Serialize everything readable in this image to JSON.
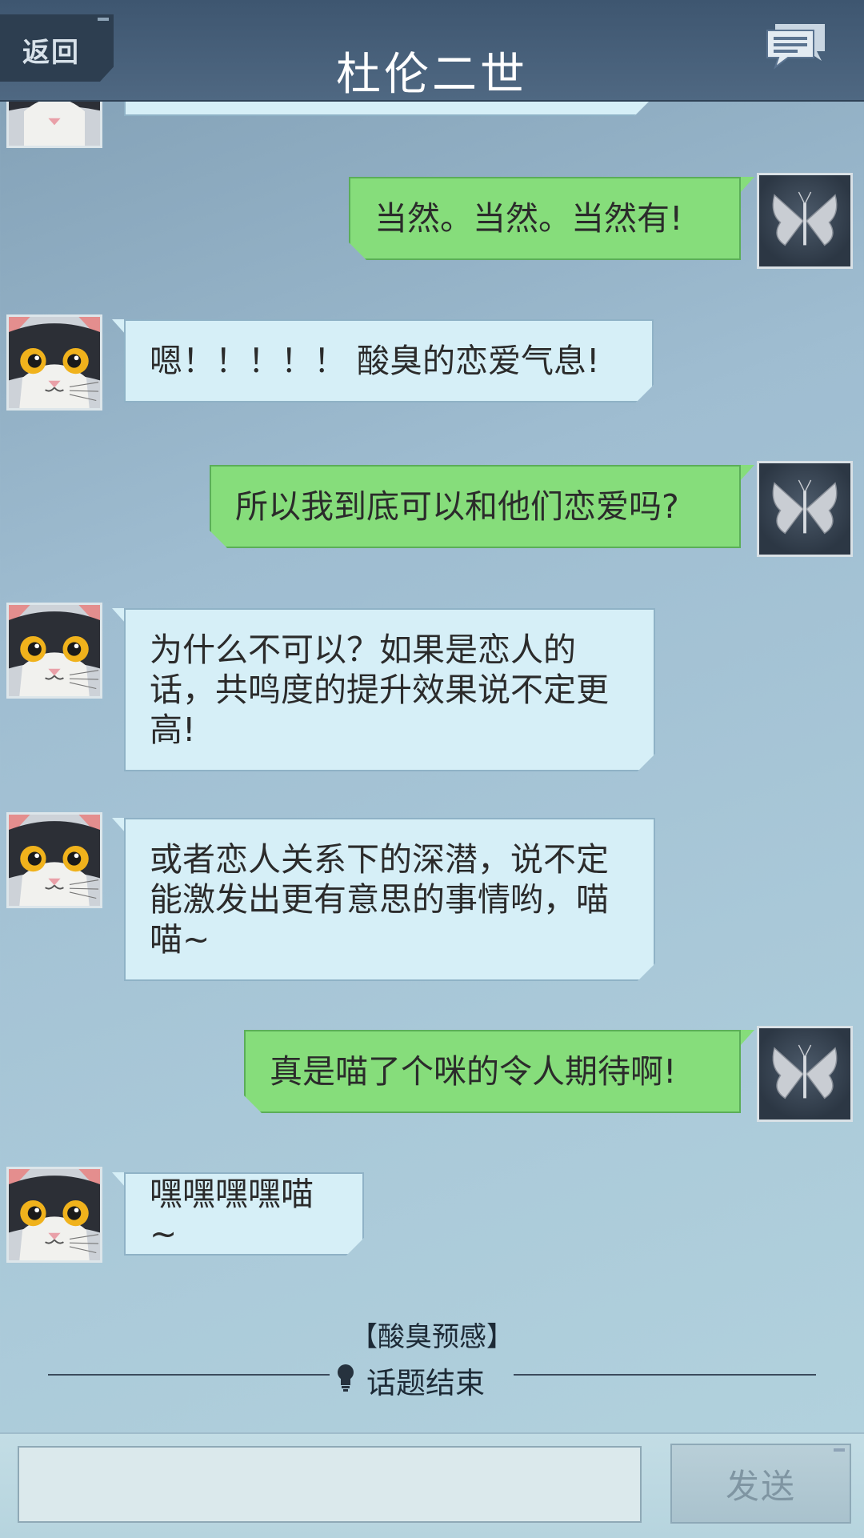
{
  "header": {
    "back_label": "返回",
    "title": "杜伦二世"
  },
  "messages": [
    {
      "side": "out",
      "text": "当然。当然。当然有!"
    },
    {
      "side": "in",
      "text": "嗯！！！！！ 酸臭的恋爱气息!"
    },
    {
      "side": "out",
      "text": "所以我到底可以和他们恋爱吗?"
    },
    {
      "side": "in",
      "text": "为什么不可以？如果是恋人的话，共鸣度的提升效果说不定更高!"
    },
    {
      "side": "in",
      "text": "或者恋人关系下的深潜，说不定能激发出更有意思的事情哟，喵喵~"
    },
    {
      "side": "out",
      "text": "真是喵了个咪的令人期待啊!"
    },
    {
      "side": "in",
      "text": "嘿嘿嘿嘿喵~"
    }
  ],
  "topic": {
    "title": "【酸臭预感】",
    "end_label": "话题结束"
  },
  "input": {
    "value": "",
    "placeholder": ""
  },
  "send_label": "发送"
}
